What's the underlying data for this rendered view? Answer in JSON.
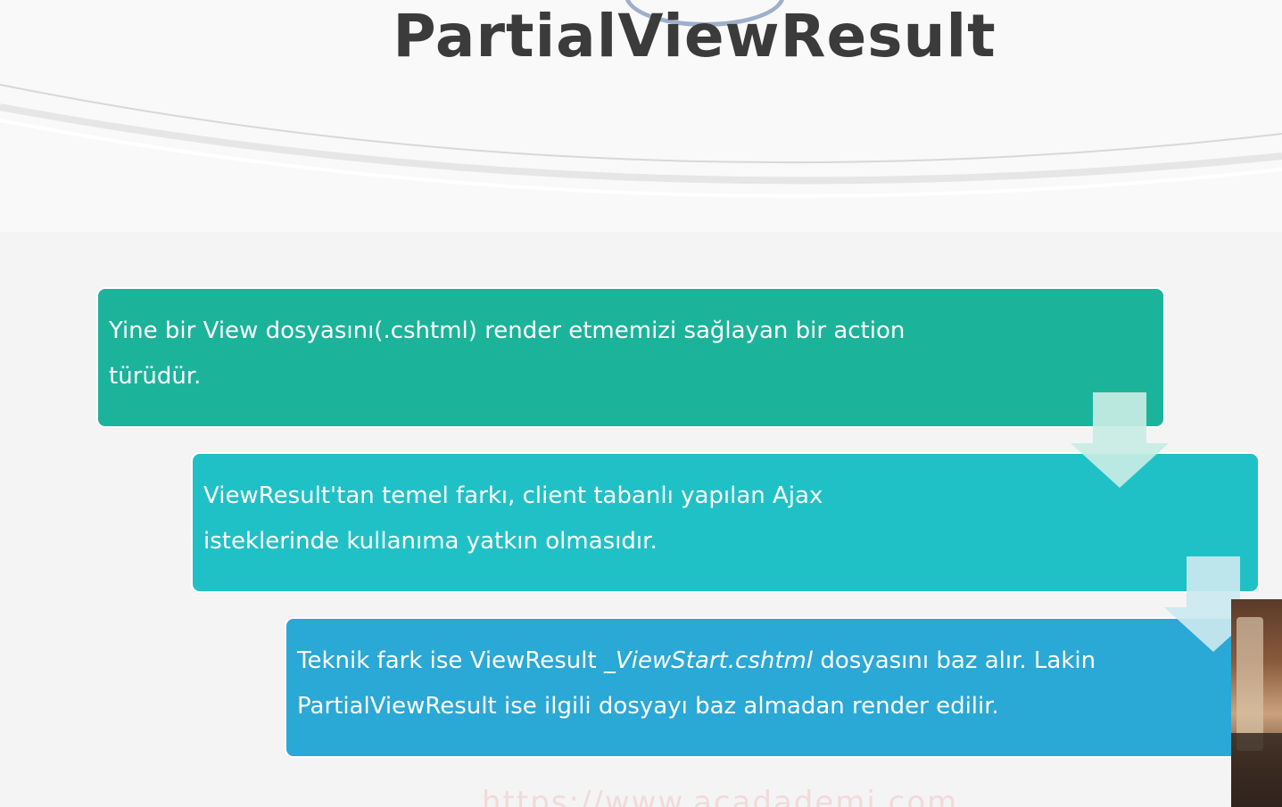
{
  "slide": {
    "title": "PartialViewResult",
    "boxes": [
      {
        "line1": "Yine bir View dosyasını(.cshtml) render etmemizi sağlayan bir action",
        "line2": "türüdür."
      },
      {
        "line1": "ViewResult'tan temel farkı, client tabanlı yapılan Ajax",
        "line2": "isteklerinde kullanıma yatkın olmasıdır."
      },
      {
        "line1_pre": "Teknik fark ise ViewResult ",
        "line1_italic": "_ViewStart.cshtml",
        "line1_post": " dosyasını baz alır. Lakin",
        "line2": "PartialViewResult ise ilgili dosyayı baz almadan render edilir."
      }
    ],
    "watermark": "https://www.acadademi.com"
  },
  "colors": {
    "box1": "#1cb39b",
    "box2": "#20c1c6",
    "box3": "#2aa8d6",
    "arrow": "#c8ebe4",
    "title": "#3b3b3b"
  },
  "icons": [
    "down-arrow-icon",
    "logo-arc-icon"
  ]
}
